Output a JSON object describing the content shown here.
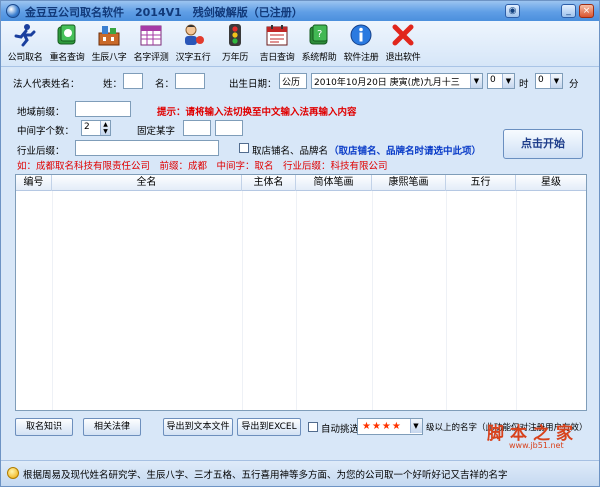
{
  "window": {
    "title": "金豆豆公司取名软件　2014V1　残剑破解版（已注册）"
  },
  "toolbar": {
    "items": [
      {
        "label": "公司取名",
        "icon": "runner-icon"
      },
      {
        "label": "重名查询",
        "icon": "green-book-icon"
      },
      {
        "label": "生辰八字",
        "icon": "building-icon"
      },
      {
        "label": "名字评测",
        "icon": "calendar-grid-icon"
      },
      {
        "label": "汉字五行",
        "icon": "person-icon"
      },
      {
        "label": "万年历",
        "icon": "traffic-light-icon"
      },
      {
        "label": "吉日查询",
        "icon": "calendar-icon"
      },
      {
        "label": "系统帮助",
        "icon": "help-book-icon"
      },
      {
        "label": "软件注册",
        "icon": "info-icon"
      },
      {
        "label": "退出软件",
        "icon": "red-x-icon"
      }
    ]
  },
  "form": {
    "legal_rep_label": "法人代表姓名：",
    "surname_label": "姓：",
    "given_label": "名：",
    "birth_label": "出生日期：",
    "calendar_type": "公历",
    "birth_date": "2010年10月20日 庚寅(虎)九月十三",
    "hour_value": "0",
    "hour_label": "时",
    "minute_value": "0",
    "minute_label": "分",
    "region_prefix_label": "地域前缀：",
    "hint": "提示：请将输入法切换至中文输入法再输入内容",
    "middle_count_label": "中间字个数：",
    "middle_count_value": "2",
    "fixed_char_label": "固定某字",
    "industry_suffix_label": "行业后缀：",
    "shop_name_label": "取店铺名、品牌名",
    "shop_name_note": "（取店铺名、品牌名时请选中此项）",
    "example": "如：成都取名科技有限责任公司　前缀：成都　中间字：取名　行业后缀：科技有限公司",
    "start_button": "点击开始"
  },
  "table": {
    "columns": [
      "编号",
      "全名",
      "主体名",
      "简体笔画",
      "康熙笔画",
      "五行",
      "星级"
    ]
  },
  "bottom": {
    "naming_knowledge": "取名知识",
    "related_laws": "相关法律",
    "export_text": "导出到文本文件",
    "export_excel": "导出到EXCEL",
    "auto_filter": "自动挑选",
    "stars": "★★★★",
    "stars_note": "级以上的名字（此功能仅对注册用户有效）"
  },
  "status": {
    "text": "根据周易及现代姓名研究学、生辰八字、三才五格、五行喜用神等多方面、为您的公司取一个好听好记又吉祥的名字"
  },
  "watermark": {
    "main": "脚本之家",
    "sub": "www.jb51.net"
  }
}
